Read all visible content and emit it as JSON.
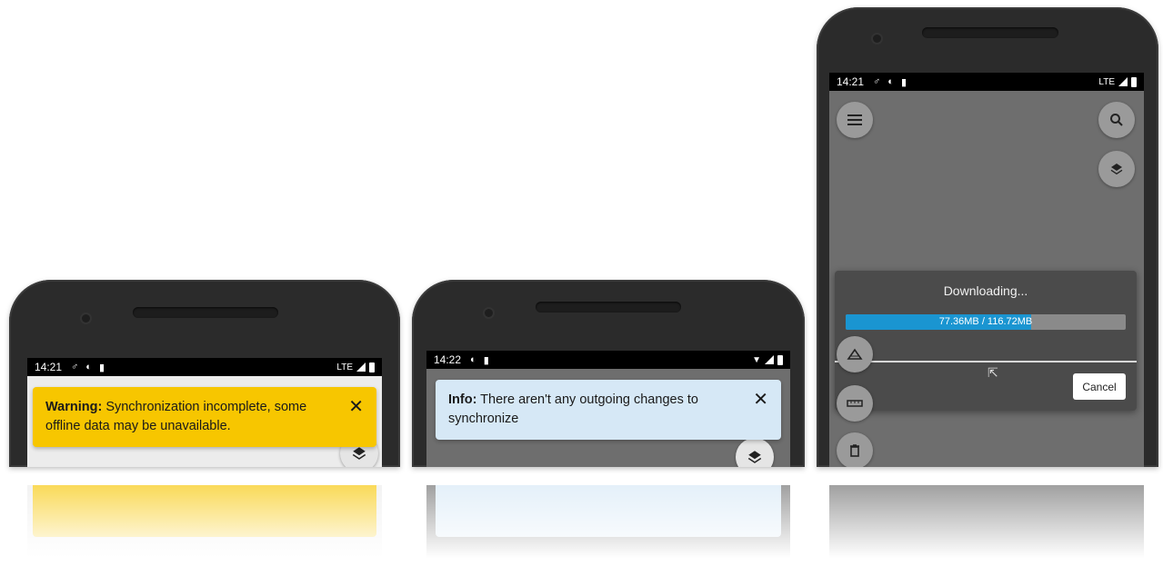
{
  "phone1": {
    "status": {
      "time": "14:21",
      "network": "LTE"
    },
    "banner": {
      "prefix": "Warning:",
      "message": " Synchronization incomplete, some offline data may be unavailable.",
      "close": "✕",
      "color": "#f7c600"
    }
  },
  "phone2": {
    "status": {
      "time": "14:22"
    },
    "banner": {
      "prefix": "Info:",
      "message": " There aren't any outgoing changes to synchronize",
      "close": "✕",
      "color": "#d6e8f6"
    }
  },
  "phone3": {
    "status": {
      "time": "14:21",
      "network": "LTE"
    },
    "dialog": {
      "title": "Downloading...",
      "progress_text": "77.36MB / 116.72MB",
      "progress_fraction": 0.663,
      "cancel_label": "Cancel"
    }
  },
  "colors": {
    "accent": "#1a95d1",
    "warning": "#f7c600",
    "info": "#d6e8f6"
  }
}
